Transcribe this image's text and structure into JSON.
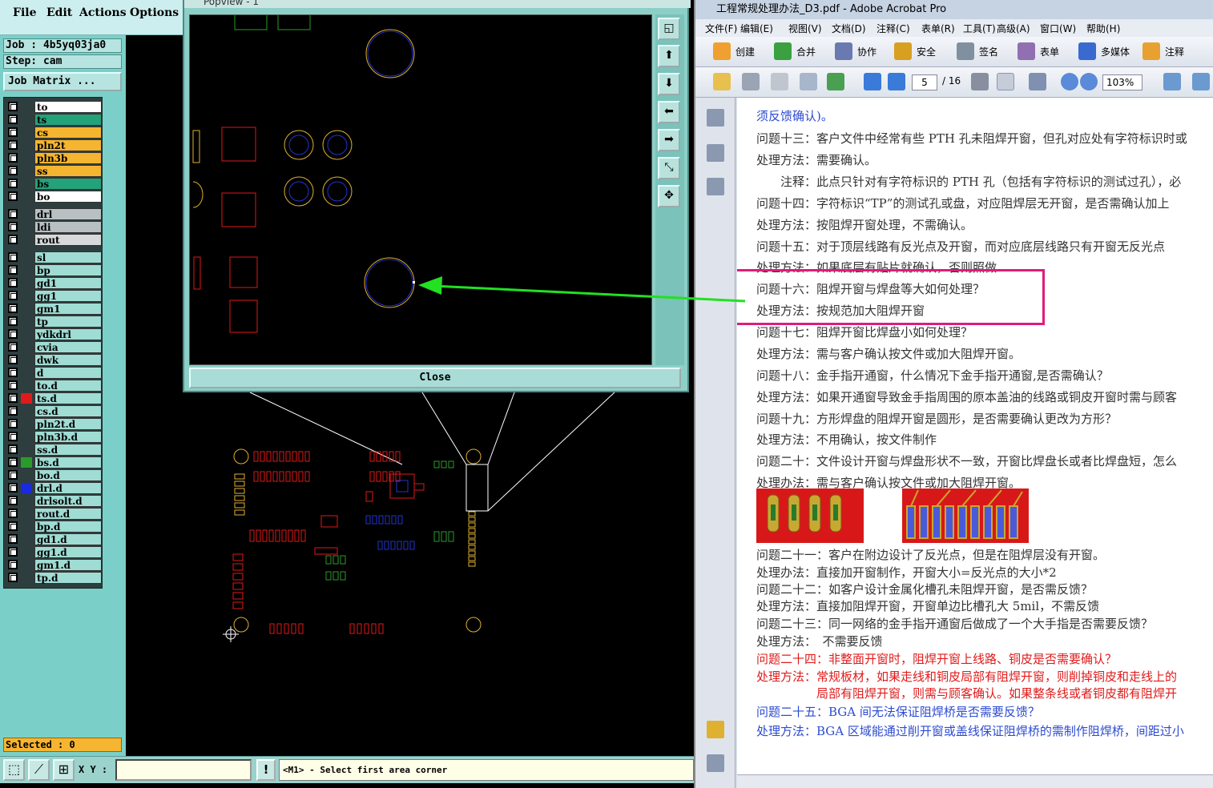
{
  "cam": {
    "menu": [
      "File",
      "Edit",
      "Actions",
      "Options"
    ],
    "job": "Job : 4b5yq03ja0",
    "step": "Step: cam",
    "job_matrix": "Job Matrix ...",
    "layers": [
      {
        "name": "to",
        "color": "#ffffff",
        "mark": "✎"
      },
      {
        "name": "ts",
        "color": "#24a27a",
        "mark": ""
      },
      {
        "name": "cs",
        "color": "#f6b530",
        "mark": "✎"
      },
      {
        "name": "pln2t",
        "color": "#f6b530",
        "mark": "✎"
      },
      {
        "name": "pln3b",
        "color": "#f6b530",
        "mark": ""
      },
      {
        "name": "ss",
        "color": "#f6b530",
        "mark": "✎"
      },
      {
        "name": "bs",
        "color": "#24a27a",
        "mark": ""
      },
      {
        "name": "bo",
        "color": "#ffffff",
        "mark": ""
      },
      {
        "name": "drl",
        "color": "#b8c0c4",
        "mark": ""
      },
      {
        "name": "ldi",
        "color": "#b8c0c4",
        "mark": ""
      },
      {
        "name": "rout",
        "color": "#d6d8da",
        "mark": ""
      },
      {
        "name": "sl",
        "color": "#9fdcd4",
        "mark": ""
      },
      {
        "name": "bp",
        "color": "#9fdcd4",
        "mark": ""
      },
      {
        "name": "gd1",
        "color": "#9fdcd4",
        "mark": "✎"
      },
      {
        "name": "gg1",
        "color": "#9fdcd4",
        "mark": ""
      },
      {
        "name": "gm1",
        "color": "#9fdcd4",
        "mark": ""
      },
      {
        "name": "tp",
        "color": "#9fdcd4",
        "mark": ""
      },
      {
        "name": "ydkdrl",
        "color": "#9fdcd4",
        "mark": ""
      },
      {
        "name": "cvia",
        "color": "#9fdcd4",
        "mark": ""
      },
      {
        "name": "dwk",
        "color": "#9fdcd4",
        "mark": ""
      },
      {
        "name": "d",
        "color": "#9fdcd4",
        "mark": ""
      },
      {
        "name": "to.d",
        "color": "#9fdcd4",
        "mark": "✎"
      },
      {
        "name": "ts.d",
        "color": "#9fdcd4",
        "mark": "▤"
      },
      {
        "name": "cs.d",
        "color": "#9fdcd4",
        "mark": "✎"
      },
      {
        "name": "pln2t.d",
        "color": "#9fdcd4",
        "mark": "✎"
      },
      {
        "name": "pln3b.d",
        "color": "#9fdcd4",
        "mark": ""
      },
      {
        "name": "ss.d",
        "color": "#9fdcd4",
        "mark": "✎"
      },
      {
        "name": "bs.d",
        "color": "#9fdcd4",
        "mark": ""
      },
      {
        "name": "bo.d",
        "color": "#9fdcd4",
        "mark": ""
      },
      {
        "name": "drl.d",
        "color": "#9fdcd4",
        "mark": ""
      },
      {
        "name": "drlsolt.d",
        "color": "#9fdcd4",
        "mark": ""
      },
      {
        "name": "rout.d",
        "color": "#9fdcd4",
        "mark": ""
      },
      {
        "name": "bp.d",
        "color": "#9fdcd4",
        "mark": ""
      },
      {
        "name": "gd1.d",
        "color": "#9fdcd4",
        "mark": "✎"
      },
      {
        "name": "gg1.d",
        "color": "#9fdcd4",
        "mark": ""
      },
      {
        "name": "gm1.d",
        "color": "#9fdcd4",
        "mark": ""
      },
      {
        "name": "tp.d",
        "color": "#9fdcd4",
        "mark": ""
      }
    ],
    "swatches": {
      "ts.d": "#e01a1a",
      "bs.d": "#2a9b2a",
      "drl.d": "#1a2ae0"
    },
    "selected": "Selected : 0",
    "xy_label": "X Y :",
    "xy_value": "",
    "excl": "!",
    "status": "<M1> - Select first area corner"
  },
  "popview": {
    "title": "Popview - 1",
    "close": "Close"
  },
  "acrobat": {
    "title": "工程常规处理办法_D3.pdf - Adobe Acrobat Pro",
    "menu": [
      "文件(F)",
      "编辑(E)",
      "视图(V)",
      "文档(D)",
      "注释(C)",
      "表单(R)",
      "工具(T)",
      "高级(A)",
      "窗口(W)",
      "帮助(H)"
    ],
    "toolbar": [
      "创建",
      "合并",
      "协作",
      "安全",
      "签名",
      "表单",
      "多媒体",
      "注释"
    ],
    "page_current": "5",
    "page_total": "/ 16",
    "zoom": "103%",
    "lines": [
      {
        "text": "须反馈确认)。",
        "color": "blue"
      },
      {
        "text": "问题十三：客户文件中经常有些 PTH 孔未阻焊开窗，但孔对应处有字符标识时或",
        "color": "gray"
      },
      {
        "text": "处理方法：需要确认。",
        "color": "gray"
      },
      {
        "text": "　　注释：此点只针对有字符标识的 PTH 孔（包括有字符标识的测试过孔），必",
        "color": "gray"
      },
      {
        "text": "问题十四：字符标识“TP”的测试孔或盘，对应阻焊层无开窗，是否需确认加上",
        "color": "gray"
      },
      {
        "text": "处理方法：按阻焊开窗处理，不需确认。",
        "color": "gray"
      },
      {
        "text": "问题十五：对于顶层线路有反光点及开窗，而对应底层线路只有开窗无反光点",
        "color": "gray"
      },
      {
        "text": "处理方法：如果底层有贴片就确认，否则照做",
        "color": "gray"
      },
      {
        "text": "问题十六：阻焊开窗与焊盘等大如何处理？",
        "color": "gray"
      },
      {
        "text": "处理方法：按规范加大阻焊开窗",
        "color": "gray"
      },
      {
        "text": "问题十七：阻焊开窗比焊盘小如何处理？",
        "color": "gray"
      },
      {
        "text": "处理方法：需与客户确认按文件或加大阻焊开窗。",
        "color": "gray"
      },
      {
        "text": "问题十八：金手指开通窗，什么情况下金手指开通窗,是否需确认？",
        "color": "gray"
      },
      {
        "text": "处理方法：如果开通窗导致金手指周围的原本盖油的线路或铜皮开窗时需与顾客",
        "color": "gray"
      },
      {
        "text": "问题十九：方形焊盘的阻焊开窗是圆形，是否需要确认更改为方形？",
        "color": "gray"
      },
      {
        "text": "处理方法：不用确认，按文件制作",
        "color": "gray"
      },
      {
        "text": "问题二十：文件设计开窗与焊盘形状不一致，开窗比焊盘长或者比焊盘短，怎么",
        "color": "gray"
      },
      {
        "text": "处理办法：需与客户确认按文件或加大阻焊开窗。",
        "color": "gray"
      },
      {
        "text": "问题二十一：客户在附边设计了反光点，但是在阻焊层没有开窗。",
        "color": "gray"
      },
      {
        "text": "处理办法：直接加开窗制作，开窗大小=反光点的大小*2",
        "color": "gray"
      },
      {
        "text": "问题二十二：如客户设计金属化槽孔未阻焊开窗，是否需反馈？",
        "color": "gray"
      },
      {
        "text": "处理方法：直接加阻焊开窗，开窗单边比槽孔大 5mil，不需反馈",
        "color": "gray"
      },
      {
        "text": "问题二十三：同一网络的金手指开通窗后做成了一个大手指是否需要反馈？",
        "color": "gray"
      },
      {
        "text": "处理方法：　不需要反馈",
        "color": "gray"
      },
      {
        "text": "问题二十四：非整面开窗时，阻焊开窗上线路、铜皮是否需要确认？",
        "color": "red"
      },
      {
        "text": "处理方法：常规板材，如果走线和铜皮局部有阻焊开窗，则削掉铜皮和走线上的",
        "color": "red"
      },
      {
        "text": "　　　　　局部有阻焊开窗，则需与顾客确认。如果整条线或者铜皮都有阻焊开",
        "color": "red"
      },
      {
        "text": "问题二十五：BGA 间无法保证阻焊桥是否需要反馈？",
        "color": "blue"
      },
      {
        "text": "处理方法：BGA 区域能通过削开窗或盖线保证阻焊桥的需制作阻焊桥，间距过小",
        "color": "blue"
      }
    ]
  }
}
